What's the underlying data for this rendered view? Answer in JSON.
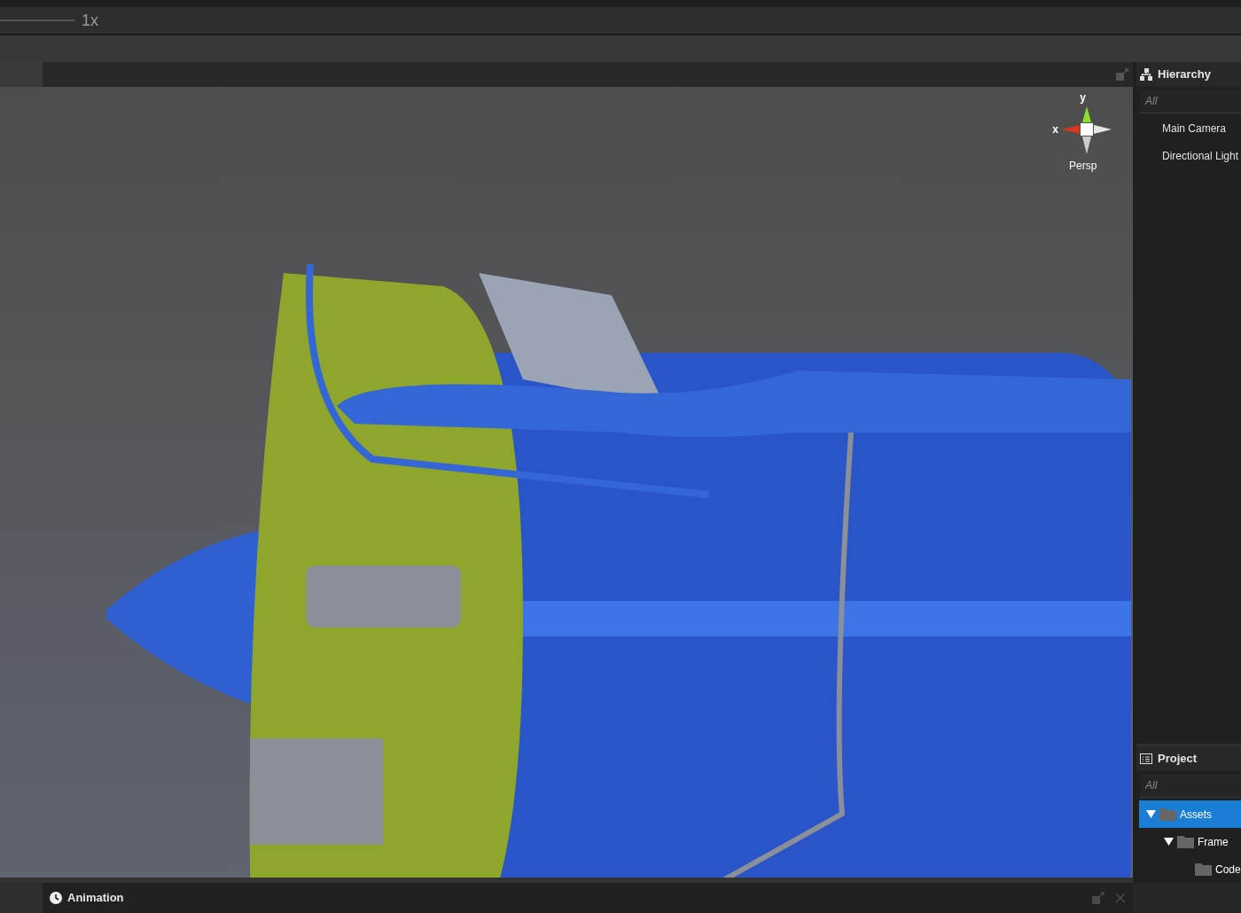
{
  "toolbar": {
    "speed_label": "1x"
  },
  "scene_view": {
    "gizmo": {
      "y_label": "y",
      "x_label": "x",
      "projection": "Persp"
    }
  },
  "hierarchy": {
    "title": "Hierarchy",
    "search_placeholder": "All",
    "items": [
      {
        "label": "Main Camera"
      },
      {
        "label": "Directional Light"
      }
    ]
  },
  "project": {
    "title": "Project",
    "search_placeholder": "All",
    "tree": [
      {
        "label": "Assets",
        "expanded": true,
        "selected": true,
        "children": [
          {
            "label": "Frame",
            "expanded": true,
            "selected": false,
            "children": [
              {
                "label": "Code",
                "selected": false
              }
            ]
          }
        ]
      }
    ]
  },
  "bottom_panel": {
    "tab": "Animation"
  }
}
